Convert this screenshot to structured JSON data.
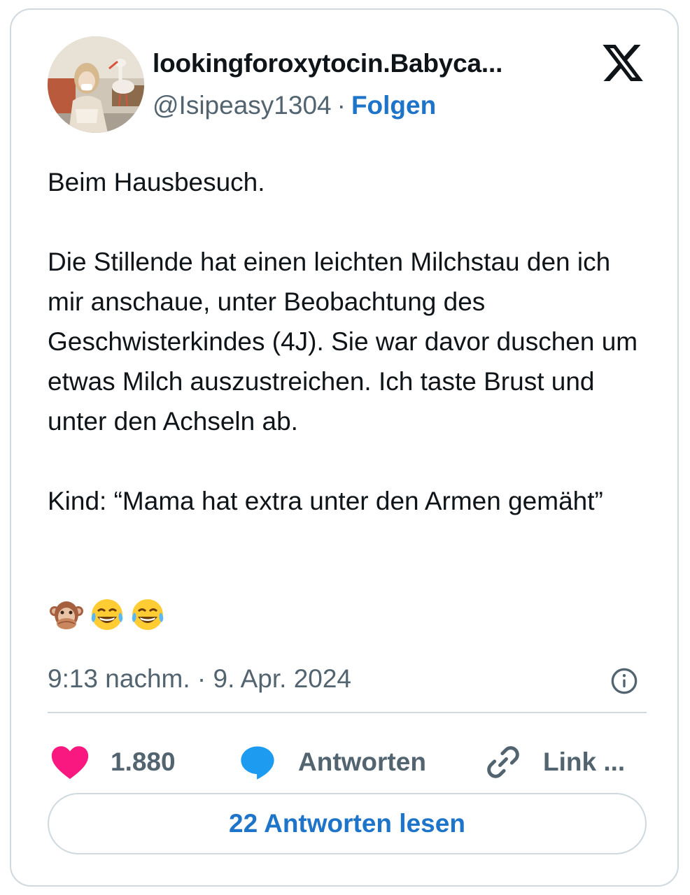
{
  "author": {
    "display_name": "lookingforoxytocin.Babyca...",
    "handle": "@Isipeasy1304",
    "separator": "·",
    "follow_label": "Folgen",
    "avatar_icon": "profile-photo-woman-with-stork"
  },
  "brand": {
    "logo_icon": "x-logo",
    "color": "#0f1419"
  },
  "tweet": {
    "paragraphs": [
      "Beim Hausbesuch.",
      "Die Stillende hat einen leichten Milchstau den ich mir anschaue, unter Beobachtung des Geschwisterkindes (4J). Sie war davor duschen um etwas Milch auszustreichen. Ich taste Brust und unter den Achseln ab.",
      "Kind: “Mama hat extra unter den Armen gemäht”"
    ],
    "emojis": [
      "🙊",
      "😂",
      "😂"
    ],
    "emoji_icons": [
      "speak-no-evil-monkey-icon",
      "tears-of-joy-icon",
      "tears-of-joy-icon"
    ],
    "timestamp": "9:13 nachm. · 9. Apr. 2024"
  },
  "actions": {
    "like_count": "1.880",
    "reply_label": "Antworten",
    "copy_link_label": "Link ...",
    "read_replies_label": "22 Antworten lesen"
  },
  "colors": {
    "text": "#0f1419",
    "secondary": "#536471",
    "link": "#1d74c8",
    "like": "#f91880",
    "reply": "#1d9bf0",
    "border": "#cfd9de"
  }
}
